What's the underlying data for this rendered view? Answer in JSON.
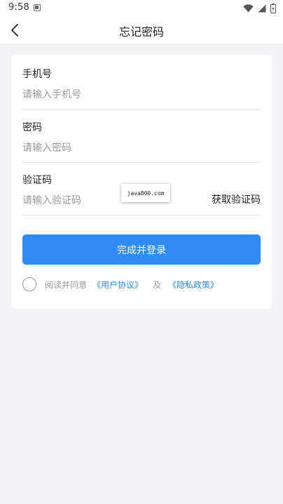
{
  "status_bar": {
    "time": "9:58",
    "notification_icon": "a-notification-icon",
    "icons": [
      "wifi-icon",
      "cellular-signal-icon",
      "battery-icon"
    ]
  },
  "header": {
    "title": "忘记密码",
    "back_icon": "chevron-left-icon"
  },
  "form": {
    "phone": {
      "label": "手机号",
      "placeholder": "请输入手机号",
      "value": ""
    },
    "password": {
      "label": "密码",
      "placeholder": "请输入密码",
      "value": ""
    },
    "code": {
      "label": "验证码",
      "placeholder": "请输入验证码",
      "value": "",
      "get_code_label": "获取验证码"
    },
    "submit_label": "完成并登录"
  },
  "watermark": {
    "text": "java800.com"
  },
  "agreement": {
    "prefix": "阅读并同意",
    "user_agreement": "《用户协议》",
    "and": "及",
    "privacy_policy": "《隐私政策》",
    "checked": false
  },
  "colors": {
    "accent": "#2f8cf6",
    "background": "#f4f4f6",
    "card": "#ffffff",
    "placeholder": "#9a9a9a",
    "divider": "#e6e6e6"
  }
}
